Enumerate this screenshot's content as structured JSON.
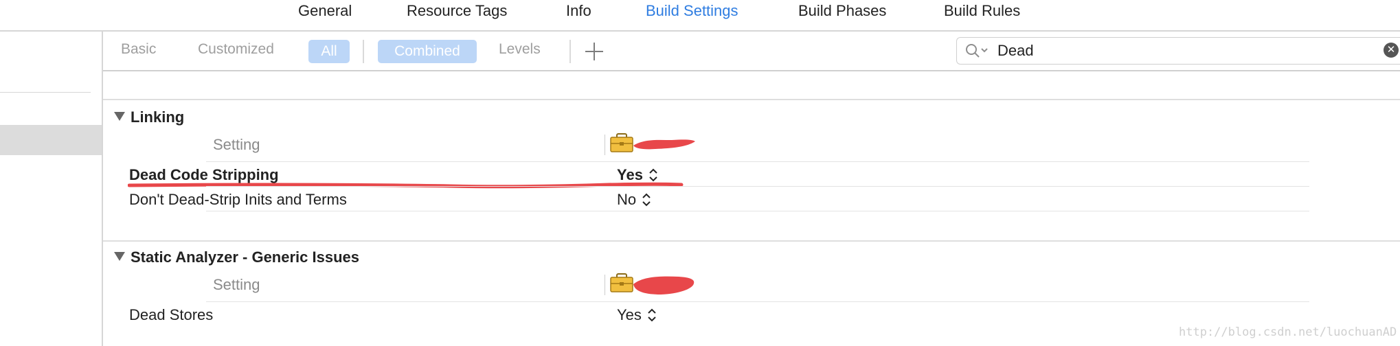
{
  "tabs": [
    {
      "label": "General",
      "active": false
    },
    {
      "label": "Resource Tags",
      "active": false
    },
    {
      "label": "Info",
      "active": false
    },
    {
      "label": "Build Settings",
      "active": true
    },
    {
      "label": "Build Phases",
      "active": false
    },
    {
      "label": "Build Rules",
      "active": false
    }
  ],
  "filters": {
    "basic": "Basic",
    "customized": "Customized",
    "all": "All",
    "combined": "Combined",
    "levels": "Levels"
  },
  "search": {
    "value": "Dead"
  },
  "sections": [
    {
      "title": "Linking",
      "column_header": "Setting",
      "rows": [
        {
          "name": "Dead Code Stripping",
          "value": "Yes",
          "bold": true
        },
        {
          "name": "Don't Dead-Strip Inits and Terms",
          "value": "No",
          "bold": false
        }
      ]
    },
    {
      "title": "Static Analyzer - Generic Issues",
      "column_header": "Setting",
      "rows": [
        {
          "name": "Dead Stores",
          "value": "Yes",
          "bold": false
        }
      ]
    }
  ],
  "colors": {
    "accent": "#2f7de1",
    "pill": "#bcd6f7",
    "annotation_red": "#e8474a"
  },
  "icons": [
    "toolbox-icon",
    "search-icon",
    "clear-icon",
    "disclosure-triangle-icon",
    "stepper-icon",
    "plus-icon"
  ],
  "watermark": "http://blog.csdn.net/luochuanAD"
}
